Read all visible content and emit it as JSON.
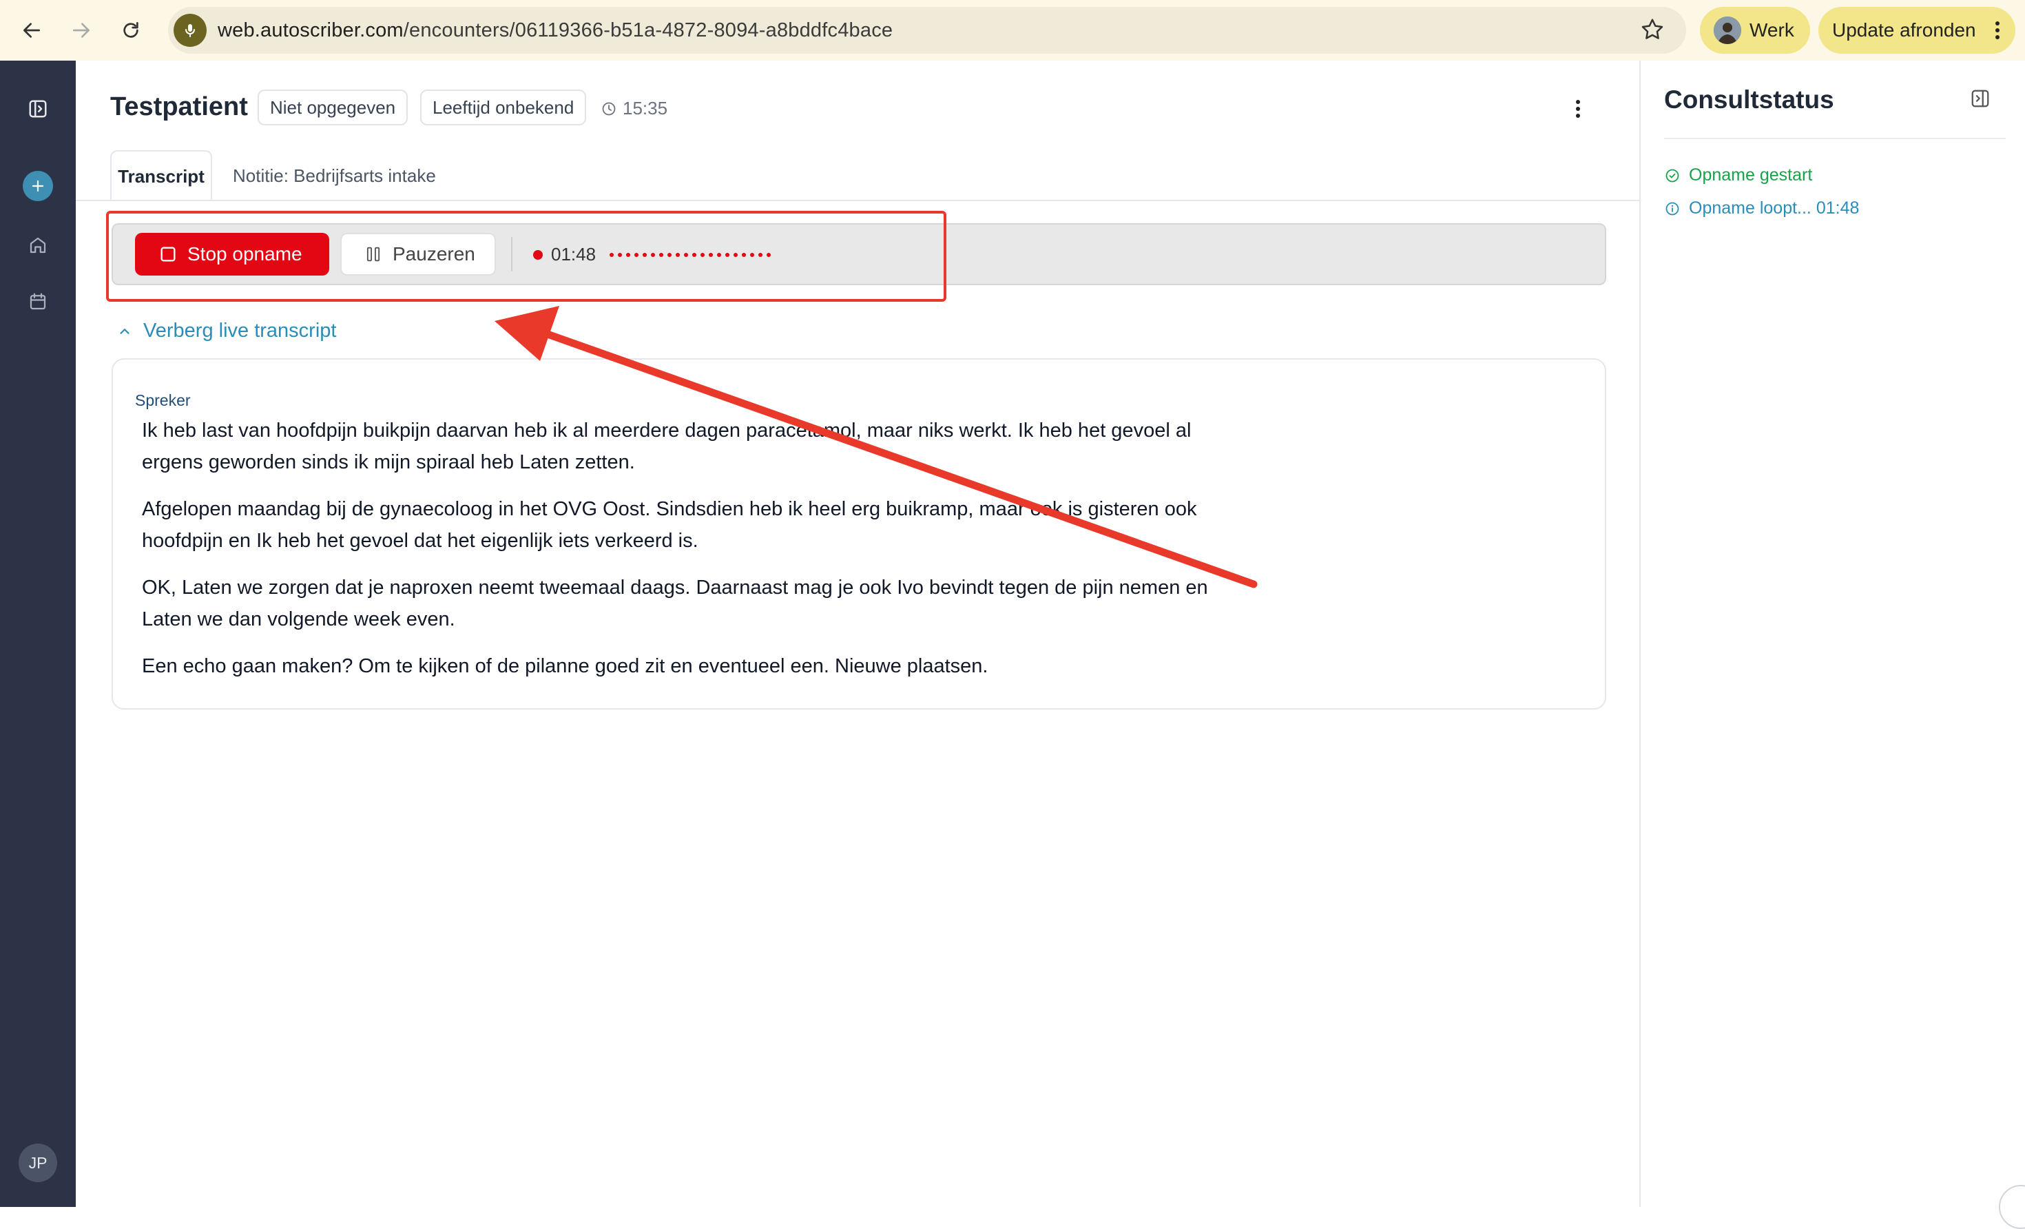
{
  "browser": {
    "url_host": "web.autoscriber.com",
    "url_path": "/encounters/06119366-b51a-4872-8094-a8bddfc4bace",
    "profile_label": "Werk",
    "update_label": "Update afronden"
  },
  "sidebar": {
    "user_initials": "JP"
  },
  "patient": {
    "name": "Testpatient",
    "gender": "Niet opgegeven",
    "age": "Leeftijd onbekend",
    "time": "15:35"
  },
  "tabs": [
    {
      "label": "Transcript",
      "active": true
    },
    {
      "label": "Notitie: Bedrijfsarts intake",
      "active": false
    }
  ],
  "recording": {
    "stop_label": "Stop opname",
    "pause_label": "Pauzeren",
    "elapsed": "01:48"
  },
  "transcript": {
    "toggle_label": "Verberg live transcript",
    "speaker": "Spreker",
    "paragraphs": [
      "Ik heb last van hoofdpijn buikpijn daarvan heb ik al meerdere dagen paracetamol, maar niks werkt. Ik heb het gevoel al ergens geworden sinds ik mijn spiraal heb Laten zetten.",
      "Afgelopen maandag bij de gynaecoloog in het OVG Oost. Sindsdien heb ik heel erg buikramp, maar ook is gisteren ook hoofdpijn en Ik heb het gevoel dat het eigenlijk iets verkeerd is.",
      "OK, Laten we zorgen dat je naproxen neemt tweemaal daags. Daarnaast mag je ook Ivo bevindt tegen de pijn nemen en Laten we dan volgende week even.",
      "Een echo gaan maken? Om te kijken of de pilanne goed zit en eventueel een. Nieuwe plaatsen."
    ]
  },
  "consult_status": {
    "title": "Consultstatus",
    "items": [
      {
        "label": "Opname gestart",
        "state": "done"
      },
      {
        "label": "Opname loopt... 01:48",
        "state": "running"
      }
    ]
  },
  "colors": {
    "accent_red": "#e30613",
    "annotation_red": "#e8392a",
    "link_blue": "#2a8db8",
    "success_green": "#16a34a",
    "sidebar_bg": "#2c3347"
  }
}
